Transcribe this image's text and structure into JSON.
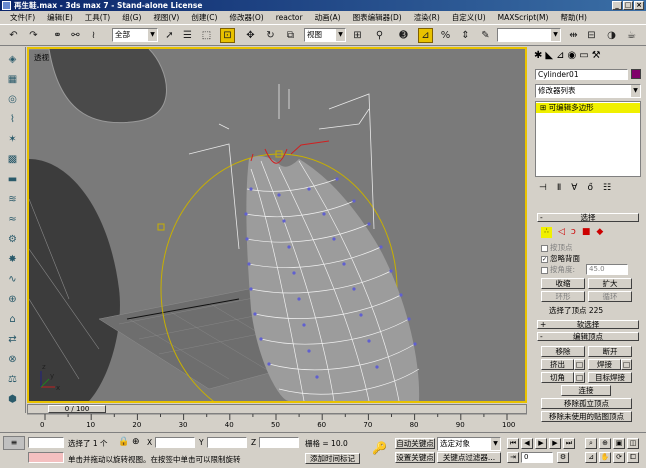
{
  "window": {
    "title": "再生鞋.max - 3ds max 7 - Stand-alone License",
    "min": "_",
    "max": "□",
    "close": "×"
  },
  "menu": [
    "文件(F)",
    "编辑(E)",
    "工具(T)",
    "组(G)",
    "视图(V)",
    "创建(C)",
    "修改器(O)",
    "reactor",
    "动画(A)",
    "图表编辑器(D)",
    "渲染(R)",
    "自定义(U)",
    "MAXScript(M)",
    "帮助(H)"
  ],
  "toolbar": {
    "filter": "全部",
    "refcoord": "视图"
  },
  "viewport": {
    "label": "透视",
    "axis_x": "x",
    "axis_y": "y",
    "axis_z": "z"
  },
  "panel": {
    "object_name": "Cylinder01",
    "modlist": "修改器列表",
    "stack_item": "可编辑多边形",
    "object_color": "#80006a",
    "selection": {
      "title": "选择",
      "by_vertex": "按顶点",
      "ignore_backfacing": "忽略背面",
      "by_angle": "按角度:",
      "angle_value": "45.0",
      "shrink": "收缩",
      "grow": "扩大",
      "ring": "环形",
      "loop": "循环",
      "status": "选择了顶点 225"
    },
    "soft_selection": {
      "title": "软选择"
    },
    "edit_vertices": {
      "title": "编辑顶点",
      "remove": "移除",
      "break": "断开",
      "extrude": "挤出",
      "weld": "焊接",
      "chamfer": "切角",
      "target_weld": "目标焊接",
      "connect": "连接",
      "remove_isolated": "移除孤立顶点",
      "remove_unused": "移除未使用的贴图顶点"
    }
  },
  "timeline": {
    "frame": "0 / 100",
    "ticks": [
      "0",
      "10",
      "20",
      "30",
      "40",
      "50",
      "60",
      "70",
      "80",
      "90",
      "100"
    ]
  },
  "status": {
    "selected": "选择了 1 个",
    "x_label": "X",
    "y_label": "Y",
    "z_label": "Z",
    "grid": "栅格 = 10.0",
    "autokey": "自动关键点",
    "setkey": "设置关键点",
    "selected_obj": "选定对象",
    "keyfilters": "关键点过滤器...",
    "prompt": "单击并拖动以旋转视图。在按签中单击可以限制旋转",
    "addtime": "添加时间标记",
    "frame_field": "0"
  }
}
